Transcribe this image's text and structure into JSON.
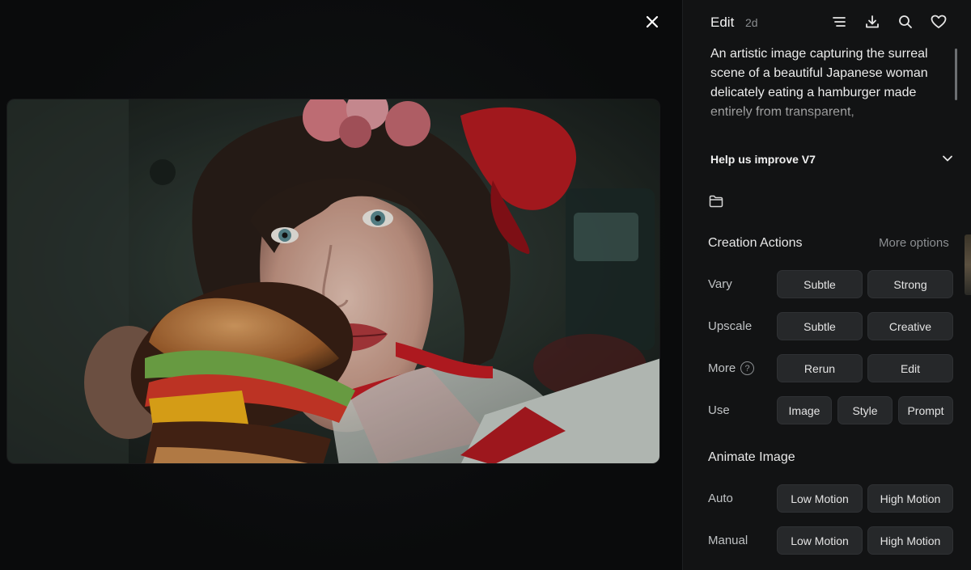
{
  "header": {
    "title": "Edit",
    "age": "2d",
    "icons": [
      "list-icon",
      "download-icon",
      "search-icon",
      "heart-icon"
    ]
  },
  "prompt": {
    "text": "An artistic image capturing the surreal scene of a beautiful Japanese woman delicately eating a hamburger made entirely from transparent,"
  },
  "feedback": {
    "label": "Help us improve V7"
  },
  "creation": {
    "title": "Creation Actions",
    "more_options": "More options",
    "vary": {
      "label": "Vary",
      "subtle": "Subtle",
      "strong": "Strong"
    },
    "upscale": {
      "label": "Upscale",
      "subtle": "Subtle",
      "creative": "Creative"
    },
    "more": {
      "label": "More",
      "help": "?",
      "rerun": "Rerun",
      "edit": "Edit"
    },
    "use": {
      "label": "Use",
      "image": "Image",
      "style": "Style",
      "prompt": "Prompt"
    }
  },
  "animate": {
    "title": "Animate Image",
    "auto": {
      "label": "Auto",
      "low": "Low Motion",
      "high": "High Motion"
    },
    "manual": {
      "label": "Manual",
      "low": "Low Motion",
      "high": "High Motion"
    }
  },
  "colors": {
    "background": "#0b0c0d",
    "panel": "#121314",
    "button": "#26282a",
    "muted_text": "#8c8f92"
  }
}
